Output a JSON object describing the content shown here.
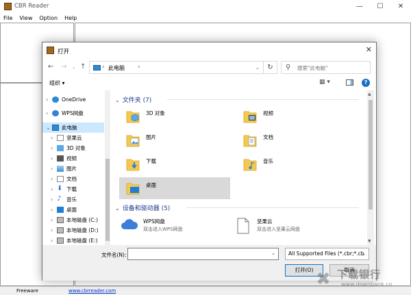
{
  "app": {
    "title": "CBR Reader",
    "menu": [
      "File",
      "View",
      "Option",
      "Help"
    ],
    "window_controls": {
      "minimize": "—",
      "maximize": "☐",
      "close": "✕"
    }
  },
  "statusbar": {
    "left": "Freeware",
    "link": "www.cbrreader.com"
  },
  "dialog": {
    "title": "打开",
    "close": "✕",
    "nav": {
      "back": "←",
      "forward": "→",
      "up": "↑"
    },
    "address": {
      "location": "此电脑"
    },
    "search": {
      "placeholder": "搜索\"此电脑\""
    },
    "toolbar": {
      "organize": "组织 ▾"
    },
    "nav_items": [
      {
        "label": "OneDrive",
        "icon": "cloud-icon",
        "arrow": "›"
      },
      {
        "label": "WPS网盘",
        "icon": "cloud-icon",
        "arrow": "›"
      },
      {
        "label": "此电脑",
        "icon": "computer-icon",
        "arrow": "⌄"
      },
      {
        "label": "坚果云",
        "icon": "file-icon",
        "arrow": "›"
      },
      {
        "label": "3D 对象",
        "icon": "3d-objects-icon",
        "arrow": "›"
      },
      {
        "label": "视频",
        "icon": "video-icon",
        "arrow": "›"
      },
      {
        "label": "图片",
        "icon": "picture-icon",
        "arrow": "›"
      },
      {
        "label": "文档",
        "icon": "document-icon",
        "arrow": "›"
      },
      {
        "label": "下载",
        "icon": "download-icon",
        "arrow": "›"
      },
      {
        "label": "音乐",
        "icon": "music-icon",
        "arrow": "›"
      },
      {
        "label": "桌面",
        "icon": "desktop-icon",
        "arrow": "›"
      },
      {
        "label": "本地磁盘 (C:)",
        "icon": "drive-icon",
        "arrow": "›"
      },
      {
        "label": "本地磁盘 (D:)",
        "icon": "drive-icon",
        "arrow": "›"
      },
      {
        "label": "本地磁盘 (E:)",
        "icon": "drive-icon",
        "arrow": "›"
      }
    ],
    "folders_header": "文件夹 (7)",
    "folders": [
      {
        "label": "3D 对象",
        "icon": "3d-objects-folder-icon"
      },
      {
        "label": "视频",
        "icon": "video-folder-icon"
      },
      {
        "label": "图片",
        "icon": "picture-folder-icon"
      },
      {
        "label": "文档",
        "icon": "document-folder-icon"
      },
      {
        "label": "下载",
        "icon": "download-folder-icon"
      },
      {
        "label": "音乐",
        "icon": "music-folder-icon"
      },
      {
        "label": "桌面",
        "icon": "desktop-folder-icon"
      }
    ],
    "drives_header": "设备和驱动器 (5)",
    "drives": [
      {
        "name": "WPS网盘",
        "desc": "双击进入WPS网盘",
        "icon": "cloud-icon"
      },
      {
        "name": "坚果云",
        "desc": "双击进入坚果云网盘",
        "icon": "file-icon"
      }
    ],
    "filename_label": "文件名(N):",
    "filename_value": "",
    "filetype": "All Supported Files (*.cbr;*.cb",
    "open_button": "打开(O)",
    "cancel_button": "取消"
  },
  "watermark": {
    "text": "下载银行",
    "url": "www.downbank.cn"
  }
}
